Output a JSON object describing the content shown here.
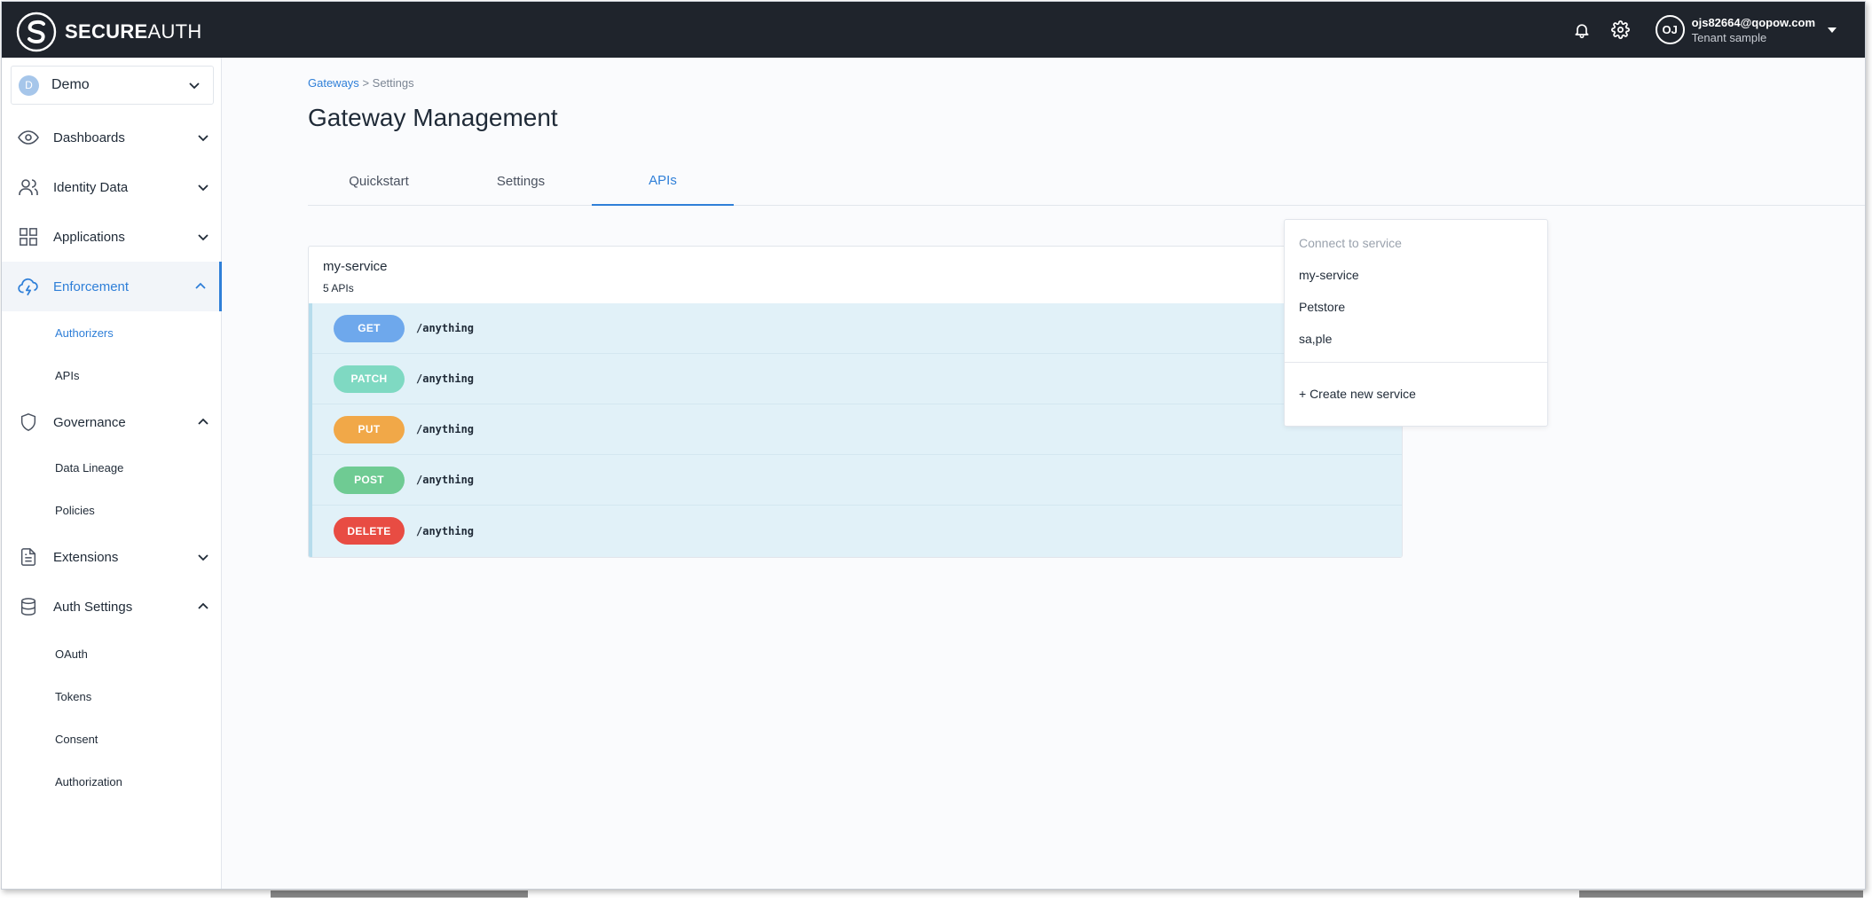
{
  "brand": {
    "name_bold": "SECURE",
    "name_light": "AUTH"
  },
  "header": {
    "user_initials": "OJ",
    "user_email": "ojs82664@qopow.com",
    "tenant_label": "Tenant",
    "tenant_name": "sample",
    "icons": [
      "bell-icon",
      "gear-icon",
      "chevron-down-icon"
    ]
  },
  "sidebar": {
    "org": {
      "initial": "D",
      "name": "Demo"
    },
    "items": [
      {
        "label": "Dashboards",
        "icon": "eye-icon",
        "expanded": false
      },
      {
        "label": "Identity Data",
        "icon": "users-icon",
        "expanded": false
      },
      {
        "label": "Applications",
        "icon": "grid-icon",
        "expanded": false
      },
      {
        "label": "Enforcement",
        "icon": "cloud-lightning-icon",
        "expanded": true,
        "active": true,
        "children": [
          "Authorizers",
          "APIs"
        ]
      },
      {
        "label": "Governance",
        "icon": "shield-icon",
        "expanded": true,
        "children": [
          "Data Lineage",
          "Policies"
        ]
      },
      {
        "label": "Extensions",
        "icon": "document-icon",
        "expanded": false
      },
      {
        "label": "Auth Settings",
        "icon": "database-icon",
        "expanded": true,
        "children": [
          "OAuth",
          "Tokens",
          "Consent",
          "Authorization"
        ]
      }
    ],
    "active_child": "Authorizers"
  },
  "main": {
    "breadcrumb": {
      "link": "Gateways",
      "separator": ">",
      "current": "Settings"
    },
    "title": "Gateway Management",
    "tabs": [
      {
        "label": "Quickstart",
        "active": false
      },
      {
        "label": "Settings",
        "active": false
      },
      {
        "label": "APIs",
        "active": true
      }
    ],
    "service": {
      "name": "my-service",
      "count": "5 APIs",
      "apis": [
        {
          "method": "GET",
          "path": "/anything",
          "color": "#6ea8ec"
        },
        {
          "method": "PATCH",
          "path": "/anything",
          "color": "#7fd9c2"
        },
        {
          "method": "PUT",
          "path": "/anything",
          "color": "#f1a848"
        },
        {
          "method": "POST",
          "path": "/anything",
          "color": "#6fcb93"
        },
        {
          "method": "DELETE",
          "path": "/anything",
          "color": "#e84c43"
        }
      ]
    },
    "dropdown": {
      "header": "Connect to service",
      "options": [
        "my-service",
        "Petstore",
        "sa,ple"
      ],
      "create": "+ Create new service"
    }
  },
  "colors": {
    "accent": "#2f7fd8",
    "topbar": "#1f242c"
  }
}
